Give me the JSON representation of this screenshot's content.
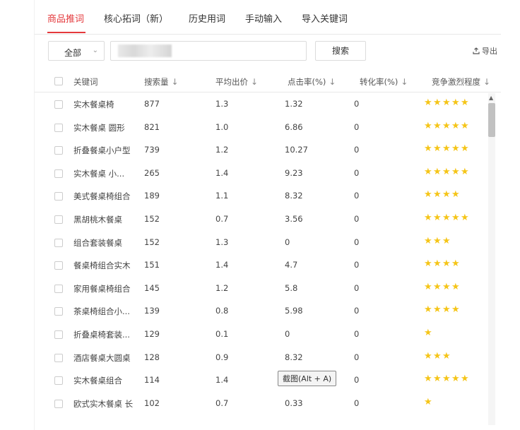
{
  "tabs": [
    {
      "label": "商品推词",
      "active": true
    },
    {
      "label": "核心拓词（新）",
      "active": false
    },
    {
      "label": "历史用词",
      "active": false
    },
    {
      "label": "手动输入",
      "active": false
    },
    {
      "label": "导入关键词",
      "active": false
    }
  ],
  "toolbar": {
    "scope_select": "全部",
    "search_value": "",
    "search_button": "搜索",
    "export_label": "导出"
  },
  "table": {
    "columns": [
      "关键词",
      "搜索量",
      "平均出价",
      "点击率(%)",
      "转化率(%)",
      "竞争激烈程度"
    ],
    "rows": [
      {
        "keyword": "实木餐桌椅",
        "search_volume": "877",
        "avg_bid": "1.3",
        "ctr": "1.32",
        "cvr": "0",
        "competition": 5
      },
      {
        "keyword": "实木餐桌 圆形",
        "search_volume": "821",
        "avg_bid": "1.0",
        "ctr": "6.86",
        "cvr": "0",
        "competition": 5
      },
      {
        "keyword": "折叠餐桌小户型",
        "search_volume": "739",
        "avg_bid": "1.2",
        "ctr": "10.27",
        "cvr": "0",
        "competition": 5
      },
      {
        "keyword": "实木餐桌 小...",
        "search_volume": "265",
        "avg_bid": "1.4",
        "ctr": "9.23",
        "cvr": "0",
        "competition": 5
      },
      {
        "keyword": "美式餐桌椅组合",
        "search_volume": "189",
        "avg_bid": "1.1",
        "ctr": "8.32",
        "cvr": "0",
        "competition": 4
      },
      {
        "keyword": "黑胡桃木餐桌",
        "search_volume": "152",
        "avg_bid": "0.7",
        "ctr": "3.56",
        "cvr": "0",
        "competition": 5
      },
      {
        "keyword": "组合套装餐桌",
        "search_volume": "152",
        "avg_bid": "1.3",
        "ctr": "0",
        "cvr": "0",
        "competition": 3
      },
      {
        "keyword": "餐桌椅组合实木",
        "search_volume": "151",
        "avg_bid": "1.4",
        "ctr": "4.7",
        "cvr": "0",
        "competition": 4
      },
      {
        "keyword": "家用餐桌椅组合",
        "search_volume": "145",
        "avg_bid": "1.2",
        "ctr": "5.8",
        "cvr": "0",
        "competition": 4
      },
      {
        "keyword": "茶桌椅组合小...",
        "search_volume": "139",
        "avg_bid": "0.8",
        "ctr": "5.98",
        "cvr": "0",
        "competition": 4
      },
      {
        "keyword": "折叠桌椅套装...",
        "search_volume": "129",
        "avg_bid": "0.1",
        "ctr": "0",
        "cvr": "0",
        "competition": 1
      },
      {
        "keyword": "酒店餐桌大圆桌",
        "search_volume": "128",
        "avg_bid": "0.9",
        "ctr": "8.32",
        "cvr": "0",
        "competition": 3
      },
      {
        "keyword": "实木餐桌组合",
        "search_volume": "114",
        "avg_bid": "1.4",
        "ctr": "",
        "cvr": "0",
        "competition": 5
      },
      {
        "keyword": "欧式实木餐桌 长",
        "search_volume": "102",
        "avg_bid": "0.7",
        "ctr": "0.33",
        "cvr": "0",
        "competition": 1
      }
    ]
  },
  "tooltip": "截图(Alt + A)",
  "colors": {
    "accent": "#e4393c",
    "star": "#f5c518"
  },
  "icons": {
    "export": "upload-icon",
    "sort": "sort-down-arrow",
    "dropdown": "chevron-down-icon"
  }
}
